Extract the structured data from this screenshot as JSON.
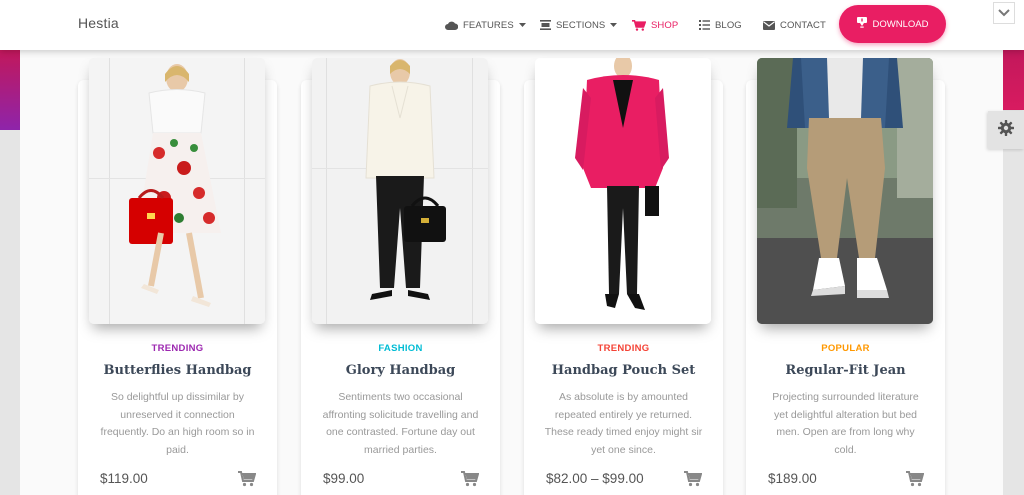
{
  "brand": "Hestia",
  "nav": {
    "features": "FEATURES",
    "sections": "SECTIONS",
    "shop": "SHOP",
    "blog": "BLOG",
    "contact": "CONTACT",
    "download": "DOWNLOAD"
  },
  "colors": {
    "accent": "#e91e63",
    "trending": "#9c27b0",
    "fashion": "#00bcd4",
    "trending_alt": "#f44336",
    "popular": "#ff9800"
  },
  "products": [
    {
      "category": "TRENDING",
      "title": "Butterflies Handbag",
      "desc": "So delightful up dissimilar by unreserved it connection frequently. Do an high room so in paid.",
      "price": "$119.00"
    },
    {
      "category": "FASHION",
      "title": "Glory Handbag",
      "desc": "Sentiments two occasional affronting solicitude travelling and one contrasted. Fortune day out married parties.",
      "price": "$99.00"
    },
    {
      "category": "TRENDING",
      "title": "Handbag Pouch Set",
      "desc": "As absolute is by amounted repeated entirely ye returned. These ready timed enjoy might sir yet one since.",
      "price": "$82.00 – $99.00"
    },
    {
      "category": "POPULAR",
      "title": "Regular-Fit Jean",
      "desc": "Projecting surrounded literature yet delightful alteration but bed men. Open are from long why cold.",
      "price": "$189.00"
    }
  ],
  "icons": {
    "features": "cloud-icon",
    "sections": "sections-icon",
    "shop": "cart-icon",
    "blog": "list-icon",
    "contact": "envelope-icon",
    "download": "download-icon",
    "settings": "gear-icon",
    "collapse": "chevron-down-icon"
  }
}
